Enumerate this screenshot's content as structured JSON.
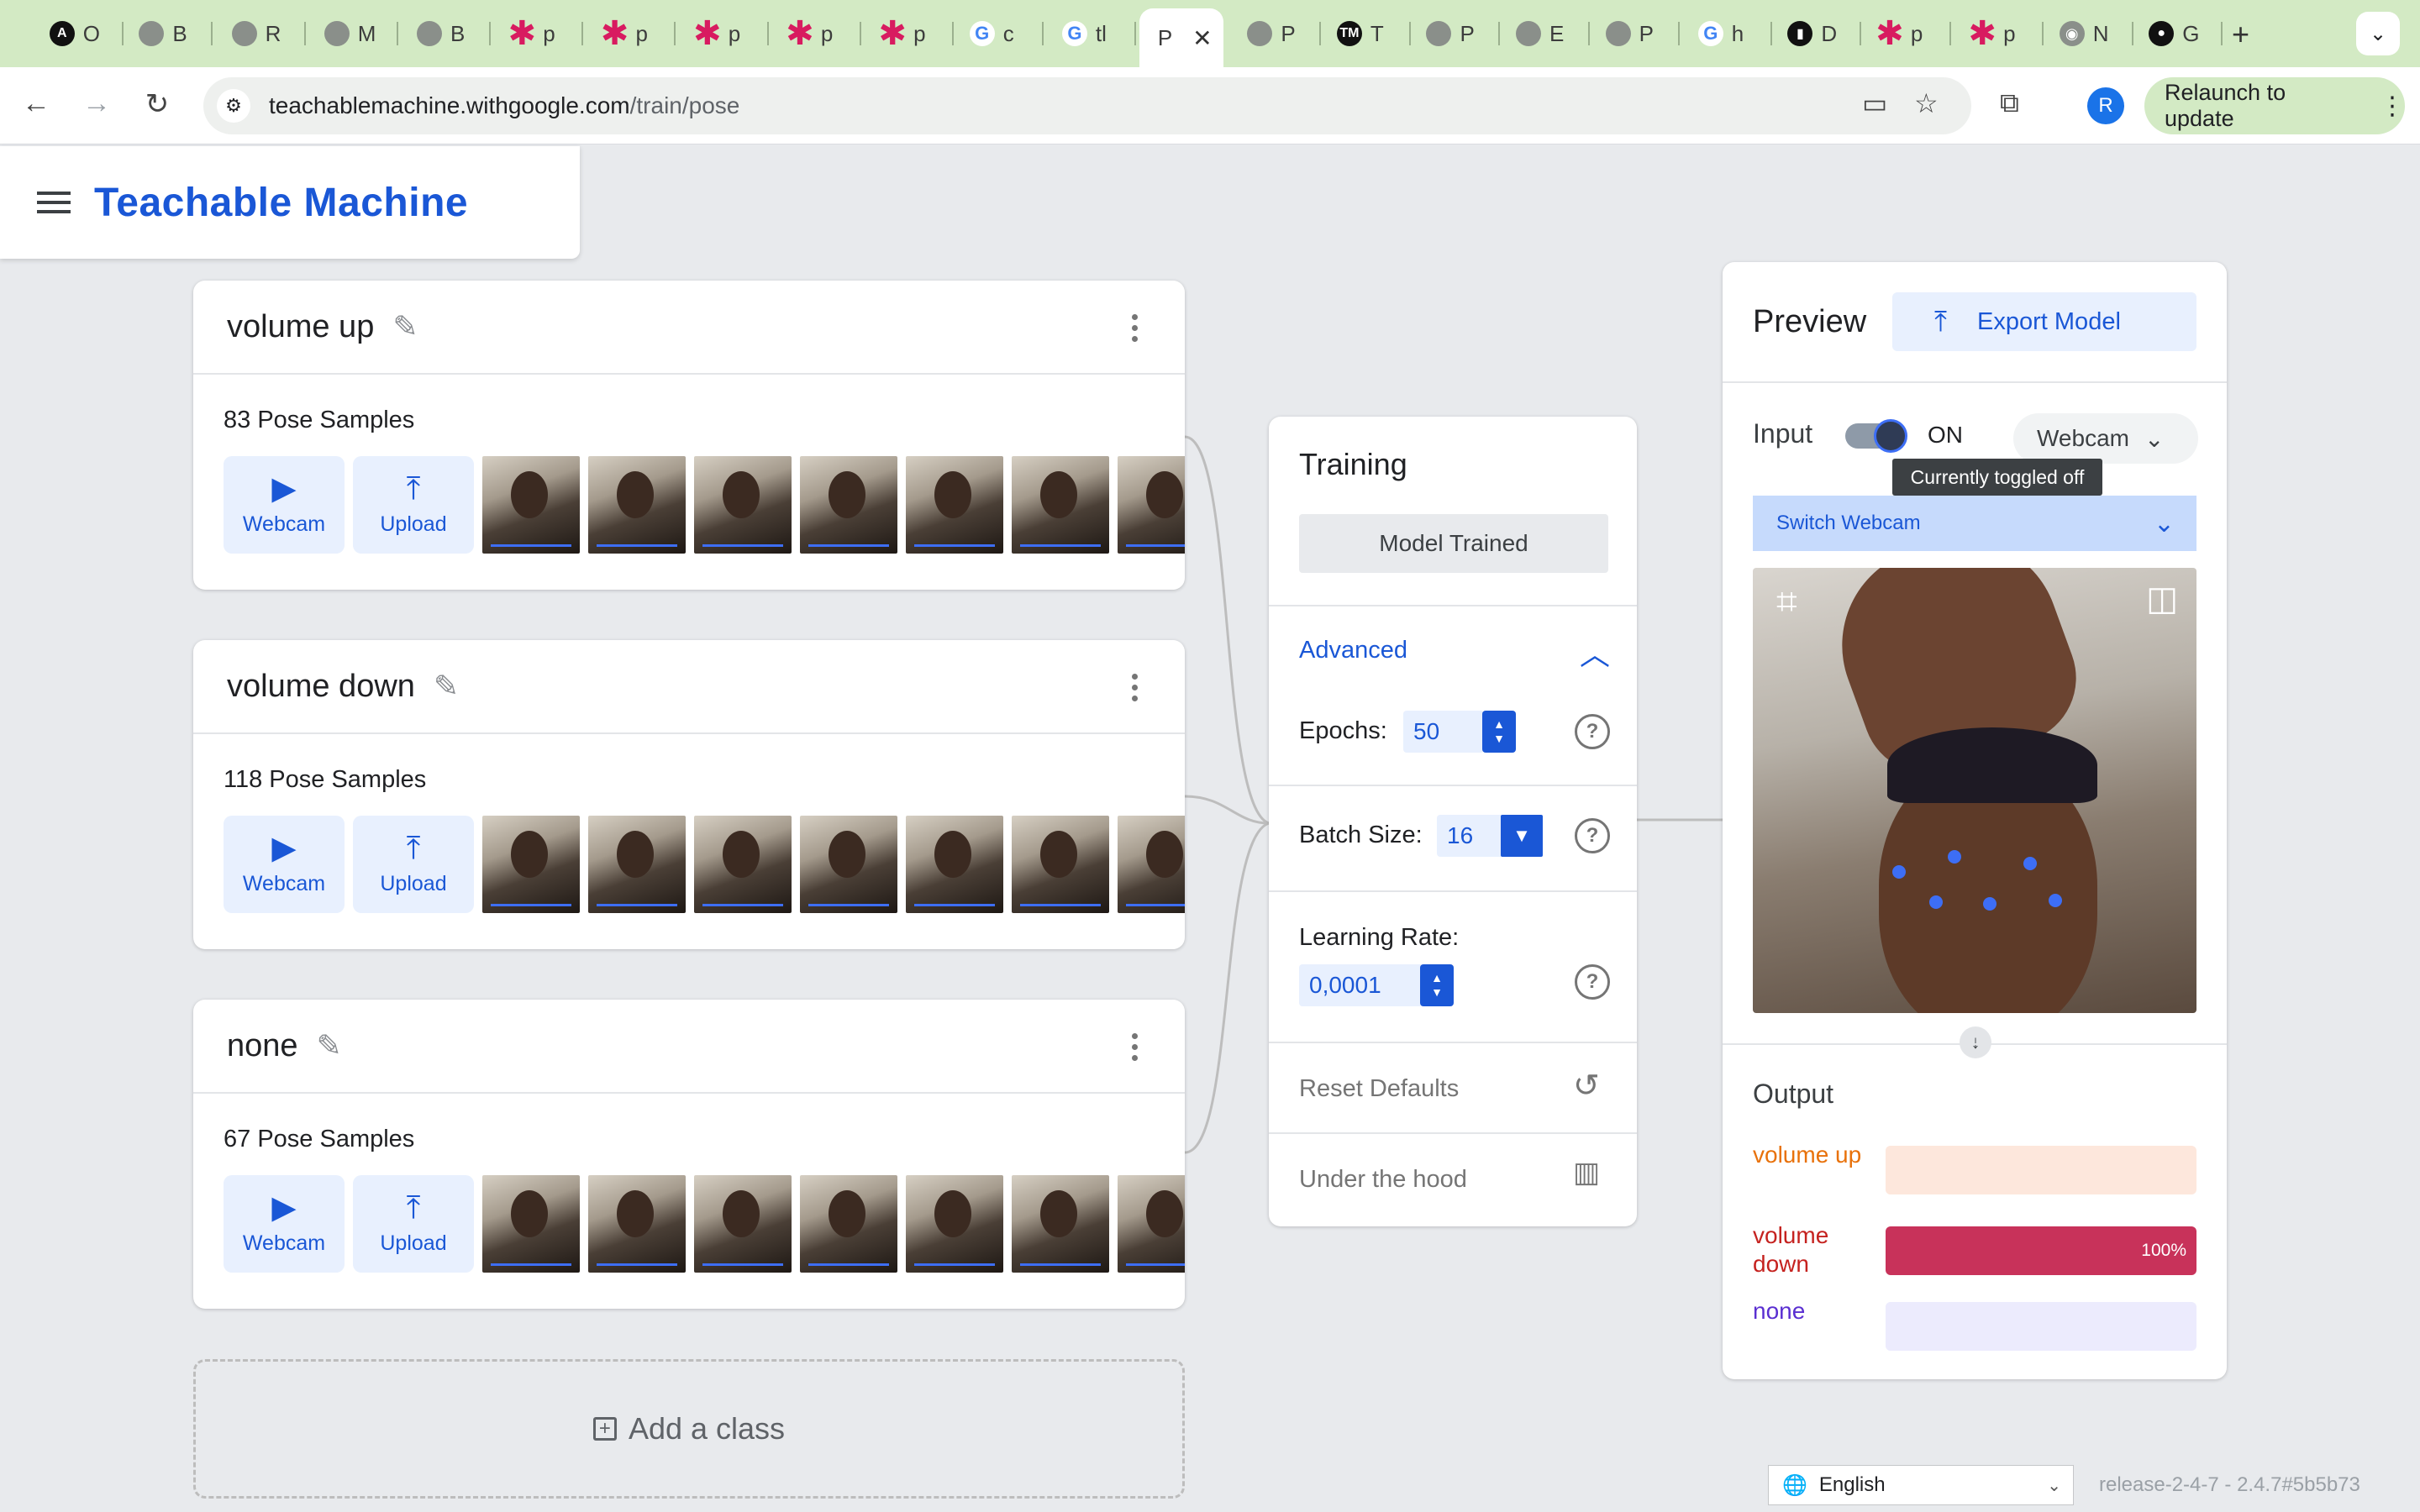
{
  "browser": {
    "tabs": [
      {
        "label": "O",
        "icon": "a-icon"
      },
      {
        "label": "B",
        "icon": "globe-icon"
      },
      {
        "label": "R",
        "icon": "globe-icon"
      },
      {
        "label": "M",
        "icon": "globe-icon"
      },
      {
        "label": "B",
        "icon": "globe-icon"
      },
      {
        "label": "p",
        "icon": "asterisk-icon"
      },
      {
        "label": "p",
        "icon": "asterisk-icon"
      },
      {
        "label": "p",
        "icon": "asterisk-icon"
      },
      {
        "label": "p",
        "icon": "asterisk-icon"
      },
      {
        "label": "p",
        "icon": "asterisk-icon"
      },
      {
        "label": "c",
        "icon": "google-icon"
      },
      {
        "label": "tl",
        "icon": "google-icon"
      },
      {
        "label": "P",
        "icon": "none",
        "active": true
      },
      {
        "label": "P",
        "icon": "globe-icon"
      },
      {
        "label": "T",
        "icon": "tm-icon"
      },
      {
        "label": "P",
        "icon": "globe-icon"
      },
      {
        "label": "E",
        "icon": "globe-icon"
      },
      {
        "label": "P",
        "icon": "globe-icon"
      },
      {
        "label": "h",
        "icon": "google-icon"
      },
      {
        "label": "D",
        "icon": "chart-icon"
      },
      {
        "label": "p",
        "icon": "asterisk-icon"
      },
      {
        "label": "p",
        "icon": "asterisk-icon"
      },
      {
        "label": "N",
        "icon": "chrome-icon"
      },
      {
        "label": "G",
        "icon": "github-icon"
      }
    ],
    "url_host": "teachablemachine.withgoogle.com",
    "url_path": "/train/pose",
    "profile_initial": "R",
    "relaunch_label": "Relaunch to update"
  },
  "app": {
    "title": "Teachable Machine"
  },
  "classes": [
    {
      "name": "volume up",
      "samples": "83 Pose Samples"
    },
    {
      "name": "volume down",
      "samples": "118 Pose Samples"
    },
    {
      "name": "none",
      "samples": "67 Pose Samples"
    }
  ],
  "sample_buttons": {
    "webcam": "Webcam",
    "upload": "Upload"
  },
  "add_class_label": "Add a class",
  "training": {
    "title": "Training",
    "button": "Model Trained",
    "advanced": "Advanced",
    "epochs_label": "Epochs:",
    "epochs_value": "50",
    "batch_label": "Batch Size:",
    "batch_value": "16",
    "lr_label": "Learning Rate:",
    "lr_value": "0,0001",
    "reset": "Reset Defaults",
    "under_hood": "Under the hood"
  },
  "preview": {
    "title": "Preview",
    "export": "Export Model",
    "input_label": "Input",
    "toggle_state": "ON",
    "source": "Webcam",
    "tooltip": "Currently toggled off",
    "switch_webcam": "Switch Webcam",
    "output_title": "Output",
    "outputs": [
      {
        "label": "volume up",
        "value": 0,
        "pct": "",
        "color": "#e8710a",
        "bg": "#fde7dc"
      },
      {
        "label": "volume down",
        "value": 1.0,
        "pct": "100%",
        "color": "#c5221f",
        "bg": "#c8325a"
      },
      {
        "label": "none",
        "value": 0,
        "pct": "",
        "color": "#5a2fd1",
        "bg": "#ecebfd"
      }
    ]
  },
  "footer": {
    "language": "English",
    "release": "release-2-4-7 - 2.4.7#5b5b73"
  }
}
